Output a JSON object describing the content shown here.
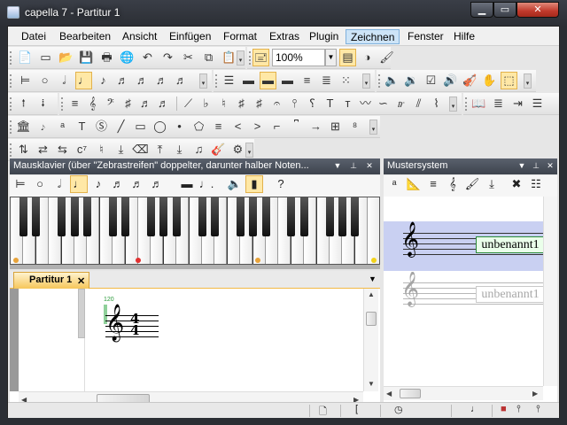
{
  "window": {
    "title": "capella 7 - Partitur 1"
  },
  "menu": {
    "items": [
      "Datei",
      "Bearbeiten",
      "Ansicht",
      "Einfügen",
      "Format",
      "Extras",
      "Plugin",
      "Zeichnen",
      "Fenster",
      "Hilfe"
    ],
    "active": "Zeichnen"
  },
  "toolbar": {
    "zoom_value": "100%"
  },
  "mausklavier": {
    "title": "Mausklavier (über \"Zebrastreifen\" doppelter, darunter halber Noten..."
  },
  "mustersystem": {
    "title": "Mustersystem",
    "rows": [
      {
        "label": "unbenannt1",
        "selected": true
      },
      {
        "label": "unbenannt1",
        "selected": false
      }
    ]
  },
  "document": {
    "tab_label": "Partitur 1",
    "tempo_marker": "120",
    "time_signature": {
      "top": "4",
      "bottom": "4"
    }
  },
  "colors": {
    "accent_tab": "#f6c65a",
    "selection": "#c9d0f2",
    "active_menu": "#cde4f7"
  },
  "icons": {
    "clef": "treble-clef",
    "close": "close-icon"
  }
}
